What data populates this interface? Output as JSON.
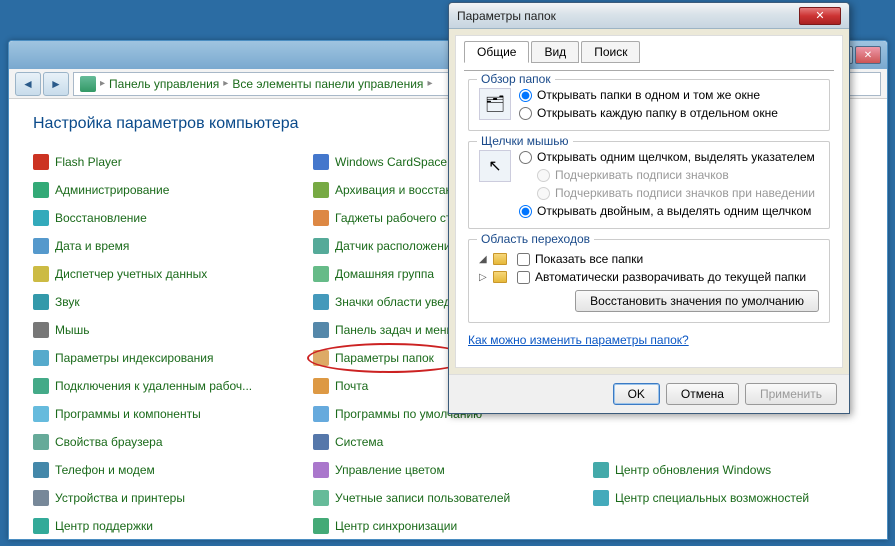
{
  "main": {
    "breadcrumb": {
      "root": "Панель управления",
      "level2": "Все элементы панели управления"
    },
    "title": "Настройка параметров компьютера",
    "col1": [
      {
        "icon": "#c32",
        "label": "Flash Player"
      },
      {
        "icon": "#3a7",
        "label": "Администрирование"
      },
      {
        "icon": "#3ab",
        "label": "Восстановление"
      },
      {
        "icon": "#59c",
        "label": "Дата и время"
      },
      {
        "icon": "#cb4",
        "label": "Диспетчер учетных данных"
      },
      {
        "icon": "#39a",
        "label": "Звук"
      },
      {
        "icon": "#777",
        "label": "Мышь"
      },
      {
        "icon": "#5ac",
        "label": "Параметры индексирования"
      },
      {
        "icon": "#4a8",
        "label": "Подключения к удаленным рабоч..."
      },
      {
        "icon": "#6bd",
        "label": "Программы и компоненты"
      },
      {
        "icon": "#6a9",
        "label": "Свойства браузера"
      },
      {
        "icon": "#48a",
        "label": "Телефон и модем"
      },
      {
        "icon": "#789",
        "label": "Устройства и принтеры"
      },
      {
        "icon": "#3a9",
        "label": "Центр поддержки"
      }
    ],
    "col2": [
      {
        "icon": "#47c",
        "label": "Windows CardSpace"
      },
      {
        "icon": "#7a4",
        "label": "Архивация и восстановление"
      },
      {
        "icon": "#d84",
        "label": "Гаджеты рабочего стола"
      },
      {
        "icon": "#5a9",
        "label": "Датчик расположения и дру..."
      },
      {
        "icon": "#6b8",
        "label": "Домашняя группа"
      },
      {
        "icon": "#49b",
        "label": "Значки области уведомлен..."
      },
      {
        "icon": "#58a",
        "label": "Панель задач и меню \"Пуск..."
      },
      {
        "icon": "#da6",
        "label": "Параметры папок",
        "circled": true
      },
      {
        "icon": "#d94",
        "label": "Почта"
      },
      {
        "icon": "#6ad",
        "label": "Программы по умолчанию"
      },
      {
        "icon": "#57a",
        "label": "Система"
      },
      {
        "icon": "#a7c",
        "label": "Управление цветом"
      },
      {
        "icon": "#6b9",
        "label": "Учетные записи пользователей"
      },
      {
        "icon": "#4a7",
        "label": "Центр синхронизации"
      }
    ],
    "col3": [
      {
        "icon": "#4aa",
        "label": "Центр обновления Windows"
      },
      {
        "icon": "#4ab",
        "label": "Центр специальных возможностей"
      }
    ]
  },
  "dialog": {
    "title": "Параметры папок",
    "tabs": {
      "general": "Общие",
      "view": "Вид",
      "search": "Поиск"
    },
    "browse": {
      "legend": "Обзор папок",
      "opt1": "Открывать папки в одном и том же окне",
      "opt2": "Открывать каждую папку в отдельном окне"
    },
    "click": {
      "legend": "Щелчки мышью",
      "opt1": "Открывать одним щелчком, выделять указателем",
      "sub1": "Подчеркивать подписи значков",
      "sub2": "Подчеркивать подписи значков при наведении",
      "opt2": "Открывать двойным, а выделять одним щелчком"
    },
    "navpane": {
      "legend": "Область переходов",
      "chk1": "Показать все папки",
      "chk2": "Автоматически разворачивать до текущей папки"
    },
    "restore": "Восстановить значения по умолчанию",
    "help": "Как можно изменить параметры папок?",
    "ok": "OK",
    "cancel": "Отмена",
    "apply": "Применить"
  }
}
